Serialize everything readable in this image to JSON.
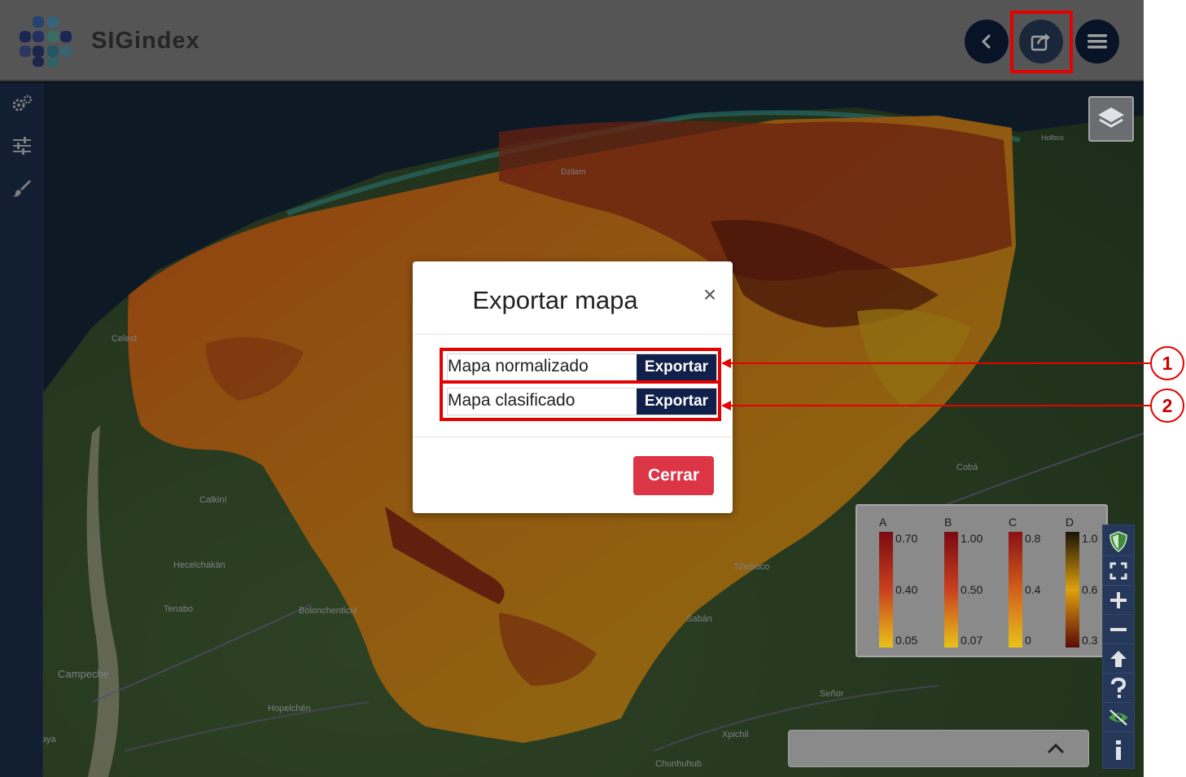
{
  "app": {
    "logo_text": "SIGindex",
    "accent_color": "#10203f",
    "dim_color": "#000000"
  },
  "header": {
    "buttons": [
      {
        "name": "back",
        "icon": "chevron-left-icon"
      },
      {
        "name": "share-export",
        "icon": "share-export-icon"
      },
      {
        "name": "menu",
        "icon": "hamburger-menu-icon"
      }
    ]
  },
  "left_toolbar": {
    "tools": [
      {
        "name": "settings",
        "icon": "gears-icon"
      },
      {
        "name": "filters",
        "icon": "sliders-icon"
      },
      {
        "name": "style",
        "icon": "paintbrush-icon"
      }
    ]
  },
  "map": {
    "place_labels": {
      "celestun": "Celest",
      "calkini": "Calkiní",
      "hecelchakan": "Hecelchakán",
      "tenabo": "Tenabo",
      "campeche": "Campeche",
      "hopelchen": "Hopelchén",
      "seybaplaya": "Seybaplaya",
      "bolonchen": "Bolonchenticul",
      "tihosuco": "Tihosuco",
      "saban": "Sabán",
      "senor": "Señor",
      "xpichil": "Xpichil",
      "chunhuhub": "Chunhuhub",
      "coba": "Cobá",
      "holbox": "Holbox",
      "dzilam": "Dzilam"
    }
  },
  "legend": {
    "columns": [
      {
        "letter": "A",
        "top": "0.70",
        "mid": "0.40",
        "bottom": "0.05",
        "gradient": [
          "#7a0a12",
          "#c8401e",
          "#e8c21a"
        ]
      },
      {
        "letter": "B",
        "top": "1.00",
        "mid": "0.50",
        "bottom": "0.07",
        "gradient": [
          "#7a0a12",
          "#c8401e",
          "#e8c21a"
        ]
      },
      {
        "letter": "C",
        "top": "0.8",
        "mid": "0.4",
        "bottom": "0",
        "gradient": [
          "#8a1014",
          "#d2601c",
          "#e8c21a"
        ]
      },
      {
        "letter": "D",
        "top": "1.0",
        "mid": "0.6",
        "bottom": "0.3",
        "gradient": [
          "#1a1206",
          "#e0a010",
          "#5a0a08"
        ]
      }
    ]
  },
  "right_controls": [
    {
      "name": "shield",
      "icon": "shield-icon"
    },
    {
      "name": "fullscreen",
      "icon": "fullscreen-icon"
    },
    {
      "name": "zoom-in",
      "icon": "plus-icon"
    },
    {
      "name": "zoom-out",
      "icon": "minus-icon"
    },
    {
      "name": "north",
      "icon": "arrow-up-icon"
    },
    {
      "name": "help",
      "icon": "question-icon"
    },
    {
      "name": "hide",
      "icon": "eye-slash-icon"
    },
    {
      "name": "info",
      "icon": "info-icon"
    }
  ],
  "modal": {
    "title": "Exportar mapa",
    "close_symbol": "×",
    "rows": [
      {
        "label": "Mapa normalizado",
        "button": "Exportar"
      },
      {
        "label": "Mapa clasificado",
        "button": "Exportar"
      }
    ],
    "cancel_label": "Cerrar",
    "cancel_color": "#dc3545"
  },
  "annotations": {
    "callout_1": "1",
    "callout_2": "2",
    "annotation_color": "#e60000"
  }
}
